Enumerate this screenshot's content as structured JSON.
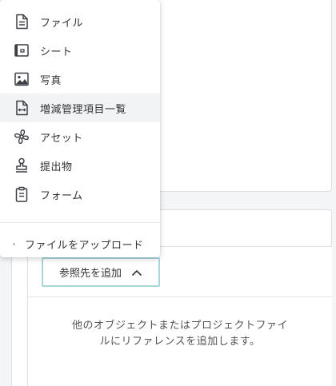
{
  "menu": {
    "items": [
      {
        "label": "ファイル",
        "icon": "file-icon"
      },
      {
        "label": "シート",
        "icon": "sheet-icon"
      },
      {
        "label": "写真",
        "icon": "photo-icon"
      },
      {
        "label": "増減管理項目一覧",
        "icon": "change-log-icon"
      },
      {
        "label": "アセット",
        "icon": "asset-icon"
      },
      {
        "label": "提出物",
        "icon": "stamp-icon"
      },
      {
        "label": "フォーム",
        "icon": "clipboard-icon"
      }
    ],
    "upload_label": "ファイルをアップロード"
  },
  "references": {
    "add_button_label": "参照先を追加",
    "empty_message": "他のオブジェクトまたはプロジェクトファイルにリファレンスを追加します。"
  },
  "colors": {
    "button_border": "#a7d7dd",
    "hover_bg": "#f2f3f4",
    "icon_stroke": "#3b3f45"
  }
}
